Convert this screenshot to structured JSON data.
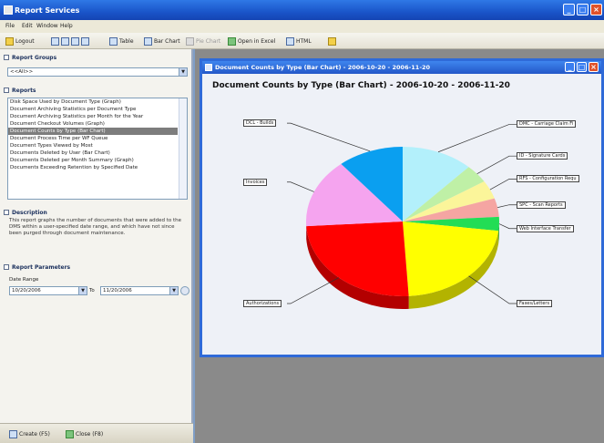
{
  "window": {
    "title": "Report Services"
  },
  "menu": [
    "File",
    "Edit",
    "Window",
    "Help"
  ],
  "toolbar": {
    "logout": "Logout",
    "table": "Table",
    "bar_chart": "Bar Chart",
    "pie_chart": "Pie Chart",
    "open_excel": "Open in Excel",
    "html": "HTML"
  },
  "left": {
    "report_groups_label": "Report Groups",
    "report_group_value": "<<All>>",
    "reports_label": "Reports",
    "reports": [
      "Disk Space Used by Document Type (Graph)",
      "Document Archiving Statistics per Document Type",
      "Document Archiving Statistics per Month for the Year",
      "Document Checkout Volumes (Graph)",
      "Document Counts by Type (Bar Chart)",
      "Document Process Time per WF Queue",
      "Document Types Viewed by Most",
      "Documents Deleted by User (Bar Chart)",
      "Documents Deleted per Month Summary (Graph)",
      "Documents Exceeding Retention by Specified Date"
    ],
    "selected_report_index": 4,
    "description_label": "Description",
    "description_text": "This report graphs the number of documents that were added to the DMS within a user-specified date range, and which have not since been purged through document maintenance.",
    "params_label": "Report Parameters",
    "date_range_label": "Date Range",
    "date_from": "10/20/2006",
    "to_label": "To",
    "date_to": "11/20/2006",
    "bottom_btn1": "Create (F5)",
    "bottom_btn2": "Close (F8)"
  },
  "chart_window": {
    "title": "Document Counts by Type (Bar Chart) - 2006-10-20 - 2006-11-20"
  },
  "chart_data": {
    "type": "pie",
    "title": "Document Counts by Type (Bar Chart) - 2006-10-20 - 2006-11-20",
    "slices": [
      {
        "label": "DMC - Carriage Claim Fi",
        "value": 12,
        "color": "#b3f0fb"
      },
      {
        "label": "ID - Signature Cards",
        "value": 4,
        "color": "#bff0a6"
      },
      {
        "label": "RFS - Configuration Requ",
        "value": 4,
        "color": "#fbf59a"
      },
      {
        "label": "SPC - Scan Reports",
        "value": 4,
        "color": "#f5a5a2"
      },
      {
        "label": "Web Interface Transfer",
        "value": 3,
        "color": "#22dd55"
      },
      {
        "label": "Faxes/Letters",
        "value": 22,
        "color": "#ffff00"
      },
      {
        "label": "Authorizations",
        "value": 25,
        "color": "#ff0000"
      },
      {
        "label": "Invoices",
        "value": 15,
        "color": "#f5a4ef"
      },
      {
        "label": "DCL - Builds",
        "value": 11,
        "color": "#0a9ff0"
      }
    ]
  }
}
